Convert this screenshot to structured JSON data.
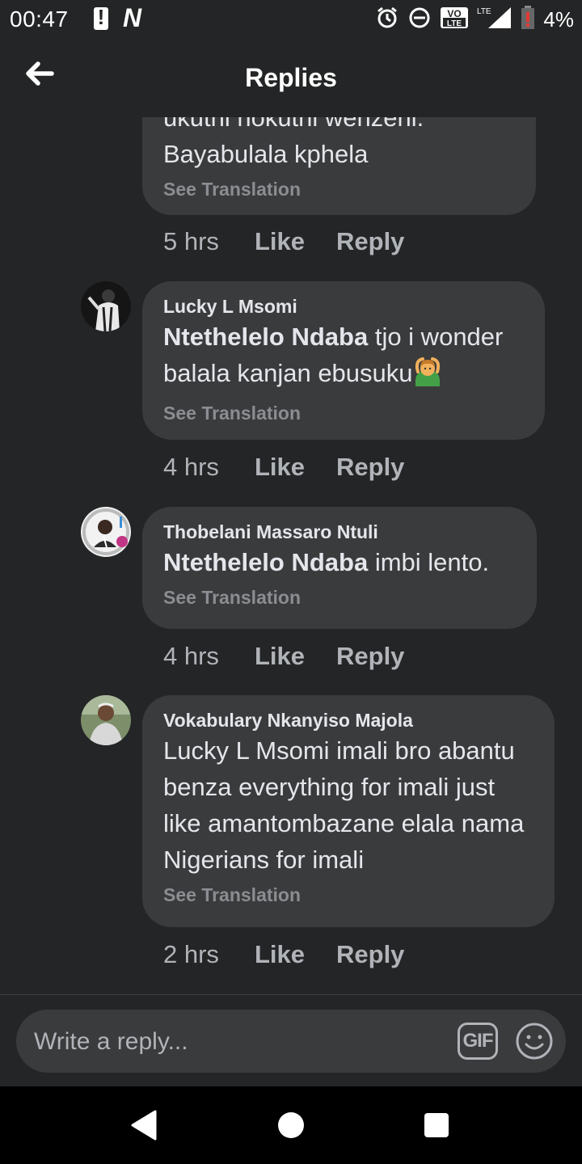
{
  "status_bar": {
    "time": "00:47",
    "battery": "4%",
    "network": "LTE",
    "volte": "VO LTE"
  },
  "header": {
    "title": "Replies"
  },
  "comments": [
    {
      "author": "",
      "mention": "",
      "text_lines": [
        "ukuthi nokuthi wenzeni.",
        "Bayabulala kphela"
      ],
      "see_translation": "See Translation",
      "time": "5 hrs",
      "like": "Like",
      "reply": "Reply"
    },
    {
      "author": "Lucky L Msomi",
      "mention": "Ntethelelo Ndaba",
      "text": " tjo i wonder balala kanjan ebusuku",
      "emoji": "person-gesturing-ok",
      "see_translation": "See Translation",
      "time": "4 hrs",
      "like": "Like",
      "reply": "Reply"
    },
    {
      "author": "Thobelani Massaro Ntuli",
      "mention": "Ntethelelo Ndaba",
      "text": " imbi lento.",
      "see_translation": "See Translation",
      "time": "4 hrs",
      "like": "Like",
      "reply": "Reply"
    },
    {
      "author": "Vokabulary Nkanyiso Majola",
      "text": "Lucky L Msomi imali bro abantu benza everything for imali just like amantombazane elala nama Nigerians for imali",
      "see_translation": "See Translation",
      "time": "2 hrs",
      "like": "Like",
      "reply": "Reply"
    }
  ],
  "composer": {
    "placeholder": "Write a reply...",
    "gif_label": "GIF"
  },
  "icons": {
    "back": "arrow-left-icon",
    "gif": "gif-icon",
    "emoji": "smiley-icon",
    "alarm": "alarm-icon",
    "dnd": "do-not-disturb-icon",
    "signal": "signal-icon",
    "battery": "battery-low-icon"
  },
  "colors": {
    "background": "#242526",
    "bubble": "#3a3b3c",
    "text": "#e4e6eb",
    "muted": "#b0b3b8"
  }
}
